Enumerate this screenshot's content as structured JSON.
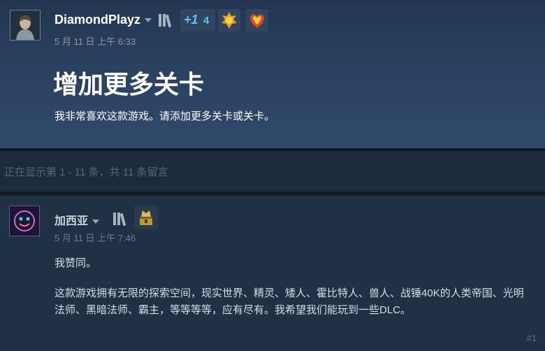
{
  "topic": {
    "author": "DiamondPlayz",
    "timestamp": "5 月 11 日 上午 6:33",
    "level_badge_plus": "+1",
    "level_badge_count": "4",
    "title": "增加更多关卡",
    "body": "我非常喜欢这款游戏。请添加更多关卡或关卡。"
  },
  "comments_info": {
    "count_text": "正在显示第 1 - 11 条，共 11 条留言"
  },
  "comment": {
    "author": "加西亚",
    "timestamp": "5 月 11 日 上午 7:46",
    "line1": "我赞同。",
    "paragraph": "这款游戏拥有无限的探索空间，现实世界、精灵、矮人、霍比特人、兽人、战锤40K的人类帝国、光明法师、黑暗法师、霸主，等等等等，应有尽有。我希望我们能玩到一些DLC。",
    "post_number": "#1"
  },
  "icons": {
    "author_dropdown": "chevron-down-icon",
    "library": "library-icon",
    "badge1": "fire-emblem-icon",
    "badge2": "flame-heart-icon",
    "comment_badge": "treasure-badge-icon"
  },
  "colors": {
    "accent_blue": "#66c0f4",
    "background": "#1b2838"
  }
}
